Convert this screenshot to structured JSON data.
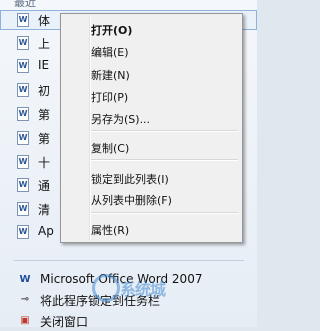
{
  "jumplist": {
    "header": "最近",
    "recent_items": [
      {
        "label": "体",
        "icon": "word-doc-icon",
        "highlighted": true
      },
      {
        "label": "上",
        "icon": "word-doc-icon"
      },
      {
        "label": "IE",
        "icon": "word-doc-icon"
      },
      {
        "label": "初",
        "icon": "word-doc-icon"
      },
      {
        "label": "第",
        "icon": "word-doc-icon"
      },
      {
        "label": "第",
        "icon": "word-doc-icon"
      },
      {
        "label": "十",
        "icon": "word-doc-icon"
      },
      {
        "label": "通",
        "icon": "word-doc-icon"
      },
      {
        "label": "清",
        "icon": "word-doc-icon"
      },
      {
        "label": "Ap",
        "icon": "word-doc-icon"
      }
    ],
    "tasks": [
      {
        "label": "Microsoft Office Word 2007",
        "icon": "word-app-icon"
      },
      {
        "label": "将此程序锁定到任务栏",
        "icon": "pin-icon"
      },
      {
        "label": "关闭窗口",
        "icon": "close-window-icon"
      }
    ]
  },
  "context_menu": {
    "open": "打开(O)",
    "edit": "编辑(E)",
    "new": "新建(N)",
    "print": "打印(P)",
    "save_as": "另存为(S)...",
    "copy": "复制(C)",
    "pin_to_list": "锁定到此列表(I)",
    "remove_from_list": "从列表中删除(F)",
    "properties": "属性(R)"
  },
  "watermark": {
    "text": "系统城"
  }
}
